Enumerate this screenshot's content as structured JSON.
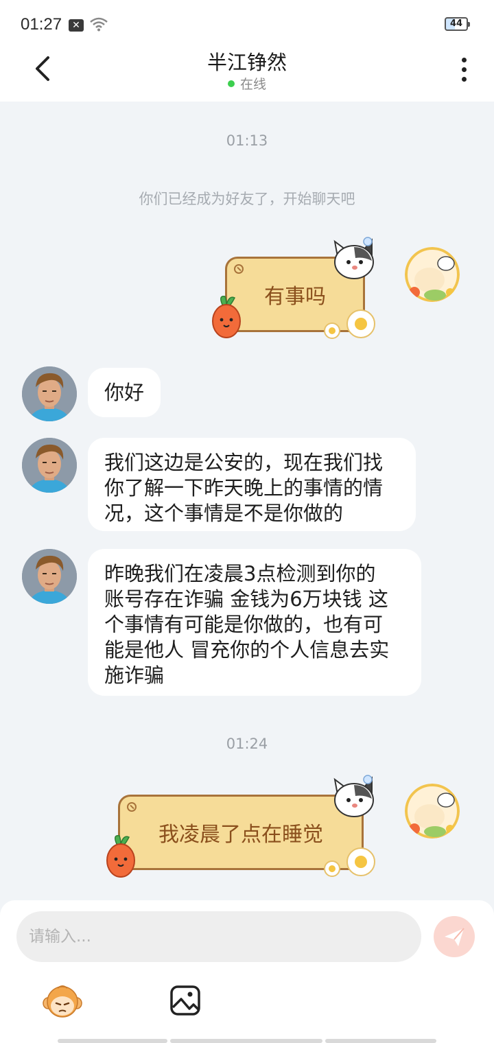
{
  "status_bar": {
    "time": "01:27",
    "battery": "44"
  },
  "header": {
    "title": "半江铮然",
    "status": "在线"
  },
  "timestamps": {
    "first": "01:13",
    "second": "01:24"
  },
  "system_message": "你们已经成为好友了，开始聊天吧",
  "messages": [
    {
      "from": "me",
      "type": "sticker",
      "text": "有事吗"
    },
    {
      "from": "other",
      "type": "text",
      "text": "你好"
    },
    {
      "from": "other",
      "type": "text",
      "lines": [
        "我们这边是公安的，现在我们找",
        "你了解一下昨天晚上的事情的情",
        "况，这个事情是不是你做的"
      ]
    },
    {
      "from": "other",
      "type": "text",
      "lines": [
        "昨晚我们在凌晨3点检测到你的",
        "账号存在诈骗 金钱为6万块钱 这",
        "个事情有可能是你做的，也有可",
        "能是他人 冒充你的个人信息去实",
        "施诈骗"
      ]
    },
    {
      "from": "me",
      "type": "sticker",
      "text": "我凌晨了点在睡觉"
    }
  ],
  "composer": {
    "placeholder": "请输入..."
  },
  "icons": [
    "back-arrow-icon",
    "more-vertical-icon",
    "wifi-icon",
    "send-icon",
    "emoji-monkey-icon",
    "image-icon"
  ],
  "colors": {
    "online_dot": "#3ccf4e",
    "sticker_board": "#f6dc98",
    "sticker_text": "#8a4f1c",
    "send_button": "#fbd7d0"
  }
}
